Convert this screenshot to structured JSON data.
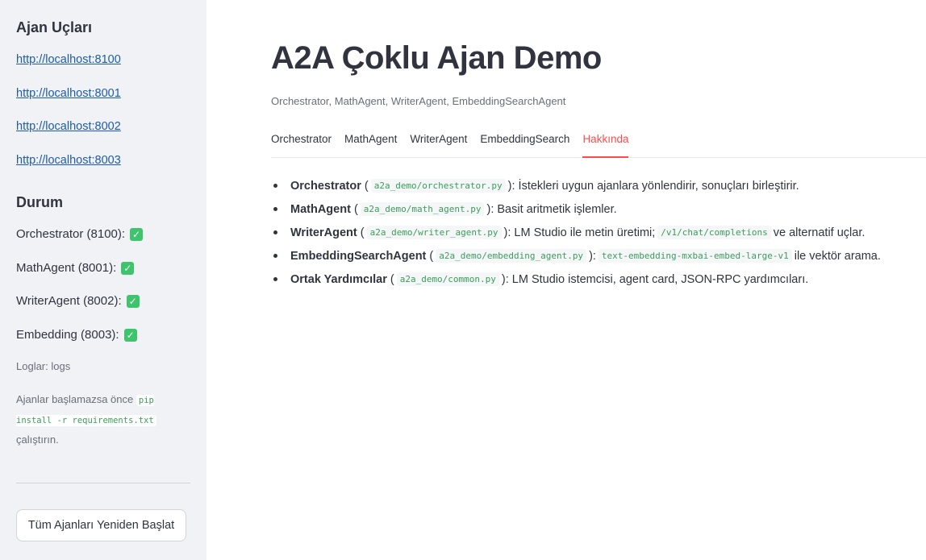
{
  "sidebar": {
    "endpoints_heading": "Ajan Uçları",
    "links": [
      "http://localhost:8100",
      "http://localhost:8001",
      "http://localhost:8002",
      "http://localhost:8003"
    ],
    "status_heading": "Durum",
    "statuses": [
      "Orchestrator (8100):",
      "MathAgent (8001):",
      "WriterAgent (8002):",
      "Embedding (8003):"
    ],
    "logs_text": "Loglar: logs",
    "note_prefix": "Ajanlar başlamazsa önce",
    "note_code": "pip install -r requirements.txt",
    "note_suffix": "çalıştırın.",
    "restart_button": "Tüm Ajanları Yeniden Başlat"
  },
  "main": {
    "title": "A2A Çoklu Ajan Demo",
    "subtitle": "Orchestrator, MathAgent, WriterAgent, EmbeddingSearchAgent",
    "tabs": [
      "Orchestrator",
      "MathAgent",
      "WriterAgent",
      "EmbeddingSearch",
      "Hakkında"
    ],
    "active_tab": "Hakkında",
    "items": [
      {
        "name": "Orchestrator",
        "file": "a2a_demo/orchestrator.py",
        "desc": "): İstekleri uygun ajanlara yönlendirir, sonuçları birleştirir."
      },
      {
        "name": "MathAgent",
        "file": "a2a_demo/math_agent.py",
        "desc": "): Basit aritmetik işlemler."
      },
      {
        "name": "WriterAgent",
        "file": "a2a_demo/writer_agent.py",
        "desc": "): LM Studio ile metin üretimi;",
        "code2": "/v1/chat/completions",
        "desc2": "ve alternatif uçlar."
      },
      {
        "name": "EmbeddingSearchAgent",
        "file": "a2a_demo/embedding_agent.py",
        "desc": "):",
        "code2": "text-embedding-mxbai-embed-large-v1",
        "desc2": "ile vektör arama."
      },
      {
        "name": "Ortak Yardımcılar",
        "file": "a2a_demo/common.py",
        "desc": "): LM Studio istemcisi, agent card, JSON-RPC yardımcıları."
      }
    ]
  },
  "colors": {
    "sidebar_bg": "#f0f2f6",
    "accent": "#ff4b4b",
    "link": "#1f5ca8",
    "code": "#3b9d5a",
    "check": "#3ec46d"
  },
  "icons": {
    "status_icon": "check-icon"
  }
}
